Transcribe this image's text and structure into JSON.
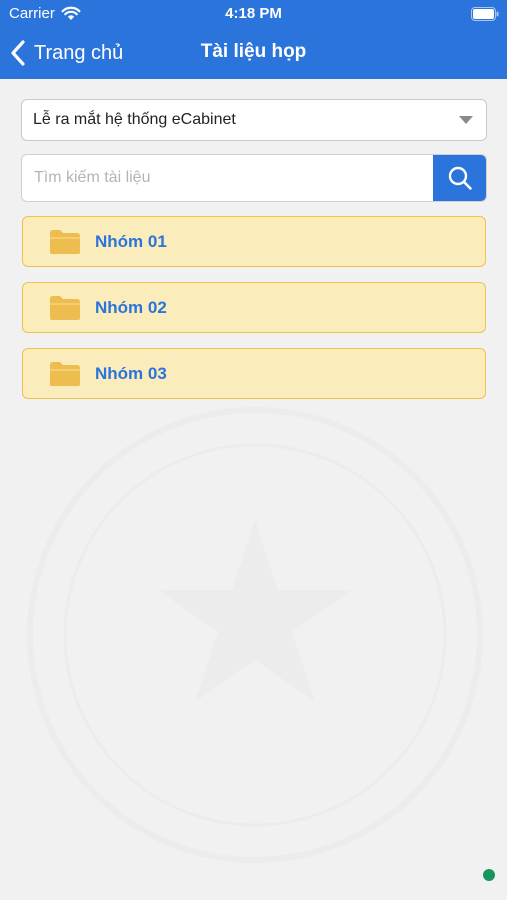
{
  "status_bar": {
    "carrier": "Carrier",
    "time": "4:18 PM"
  },
  "nav": {
    "back_label": "Trang chủ",
    "title": "Tài liệu họp"
  },
  "selector": {
    "value": "Lễ ra mắt hệ thống eCabinet"
  },
  "search": {
    "placeholder": "Tìm kiếm tài liệu",
    "value": ""
  },
  "folders": [
    {
      "label": "Nhóm 01"
    },
    {
      "label": "Nhóm 02"
    },
    {
      "label": "Nhóm 03"
    }
  ],
  "colors": {
    "header": "#2a74db",
    "folder_bg": "#faecbb",
    "folder_border": "#eec24b",
    "folder_icon": "#eebd4f",
    "accent_text": "#2a74db",
    "status_dot": "#16965a"
  },
  "icons": [
    "wifi-icon",
    "battery-icon",
    "back-chevron-icon",
    "caret-down-icon",
    "search-icon",
    "folder-icon"
  ]
}
